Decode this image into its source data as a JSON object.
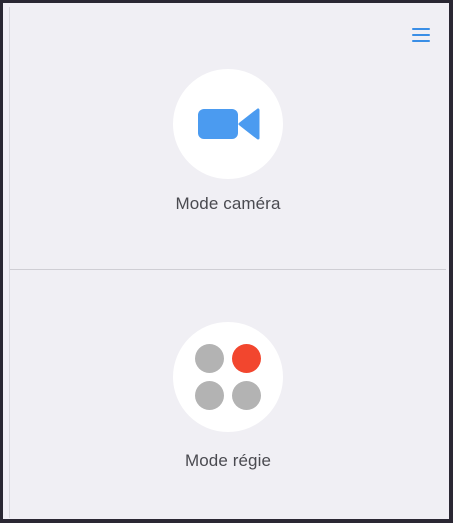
{
  "header": {
    "menu_icon": "hamburger-menu-icon"
  },
  "modes": [
    {
      "label": "Mode caméra",
      "icon": "video-camera-icon",
      "icon_color": "#4b9bf0"
    },
    {
      "label": "Mode régie",
      "icon": "four-dots-grid-icon",
      "dot_colors": [
        "#b3b3b3",
        "#f2462e",
        "#b3b3b3",
        "#b3b3b3"
      ]
    }
  ],
  "colors": {
    "accent": "#3a8ee6",
    "background": "#f0eff4",
    "circle": "#ffffff",
    "divider": "#cfced4"
  }
}
